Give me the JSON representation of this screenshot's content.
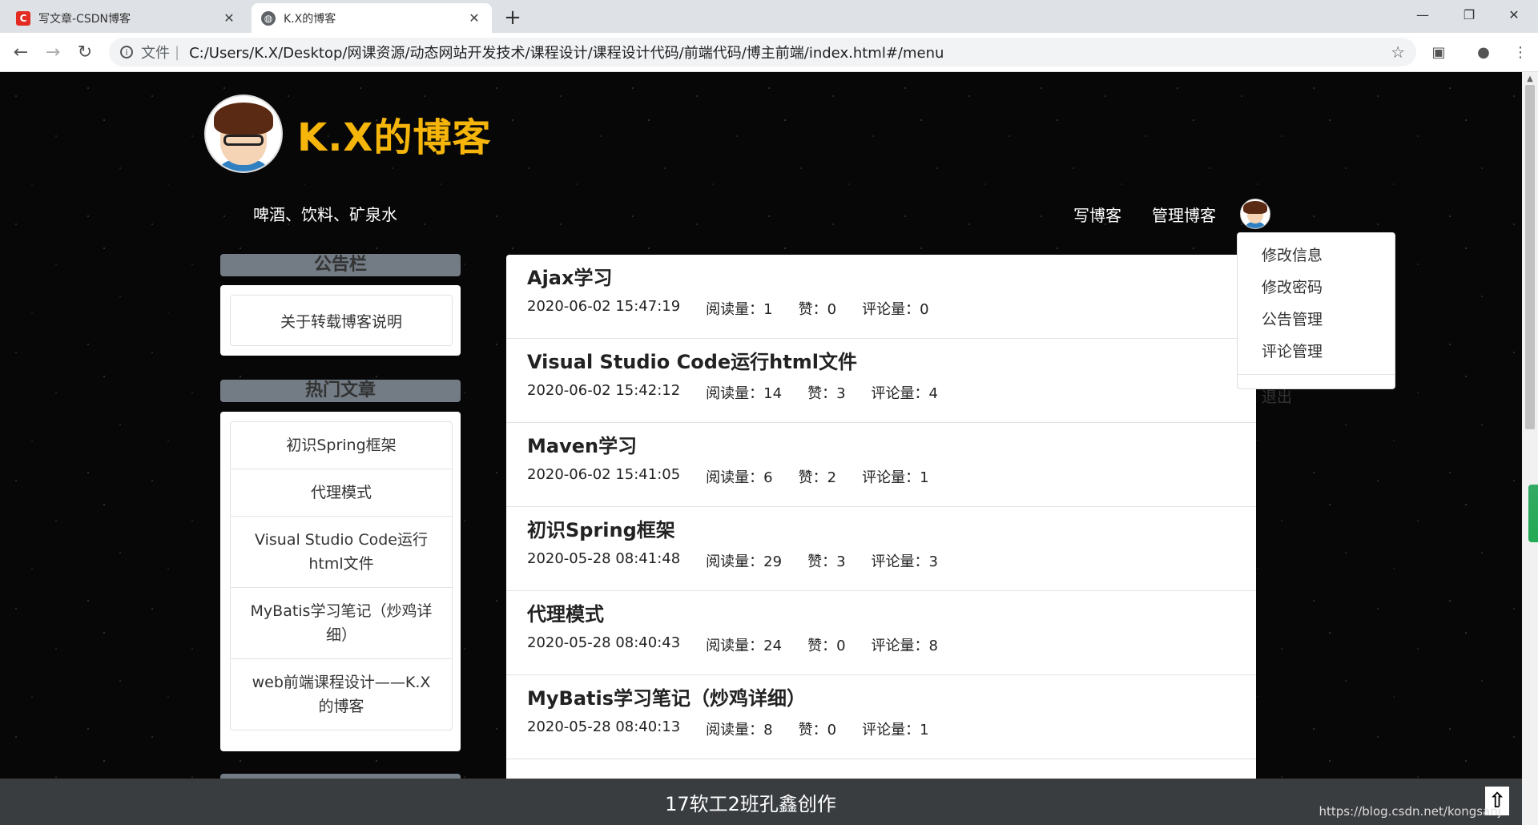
{
  "browser": {
    "tabs": [
      {
        "title": "写文章-CSDN博客",
        "favicon": "csdn-icon",
        "favicon_color": "#e32b21"
      },
      {
        "title": "K.X的博客",
        "favicon": "globe-icon",
        "favicon_color": "#5f6368"
      }
    ],
    "url_scheme": "文件",
    "url": "C:/Users/K.X/Desktop/网课资源/动态网站开发技术/课程设计/课程设计代码/前端代码/博主前端/index.html#/menu"
  },
  "header": {
    "title": "K.X的博客",
    "title_color": "#f5b50a",
    "slogan": "啤酒、饮料、矿泉水",
    "nav": {
      "write": "写博客",
      "manage": "管理博客"
    }
  },
  "dropdown": {
    "items": [
      "修改信息",
      "修改密码",
      "公告管理",
      "评论管理"
    ],
    "logout": "退出"
  },
  "sidebar": {
    "notice_title": "公告栏",
    "notice_items": [
      "关于转载博客说明"
    ],
    "hot_title": "热门文章",
    "hot_items": [
      "初识Spring框架",
      "代理模式",
      "Visual Studio Code运行html文件",
      "MyBatis学习笔记（炒鸡详细）",
      "web前端课程设计——K.X的博客"
    ]
  },
  "posts": [
    {
      "title": "Ajax学习",
      "time": "2020-06-02 15:47:19",
      "reads": "阅读量：1",
      "likes": "赞：0",
      "comments": "评论量：0"
    },
    {
      "title": "Visual Studio Code运行html文件",
      "time": "2020-06-02 15:42:12",
      "reads": "阅读量：14",
      "likes": "赞：3",
      "comments": "评论量：4"
    },
    {
      "title": "Maven学习",
      "time": "2020-06-02 15:41:05",
      "reads": "阅读量：6",
      "likes": "赞：2",
      "comments": "评论量：1"
    },
    {
      "title": "初识Spring框架",
      "time": "2020-05-28 08:41:48",
      "reads": "阅读量：29",
      "likes": "赞：3",
      "comments": "评论量：3"
    },
    {
      "title": "代理模式",
      "time": "2020-05-28 08:40:43",
      "reads": "阅读量：24",
      "likes": "赞：0",
      "comments": "评论量：8"
    },
    {
      "title": "MyBatis学习笔记（炒鸡详细）",
      "time": "2020-05-28 08:40:13",
      "reads": "阅读量：8",
      "likes": "赞：0",
      "comments": "评论量：1"
    }
  ],
  "footer": {
    "text": "17软工2班孔鑫创作",
    "watermark": "https://blog.csdn.net/kongsanj"
  },
  "colors": {
    "page_bg": "#070707",
    "section_title_bg": "#737c85",
    "footer_bg": "#3a3d40"
  }
}
